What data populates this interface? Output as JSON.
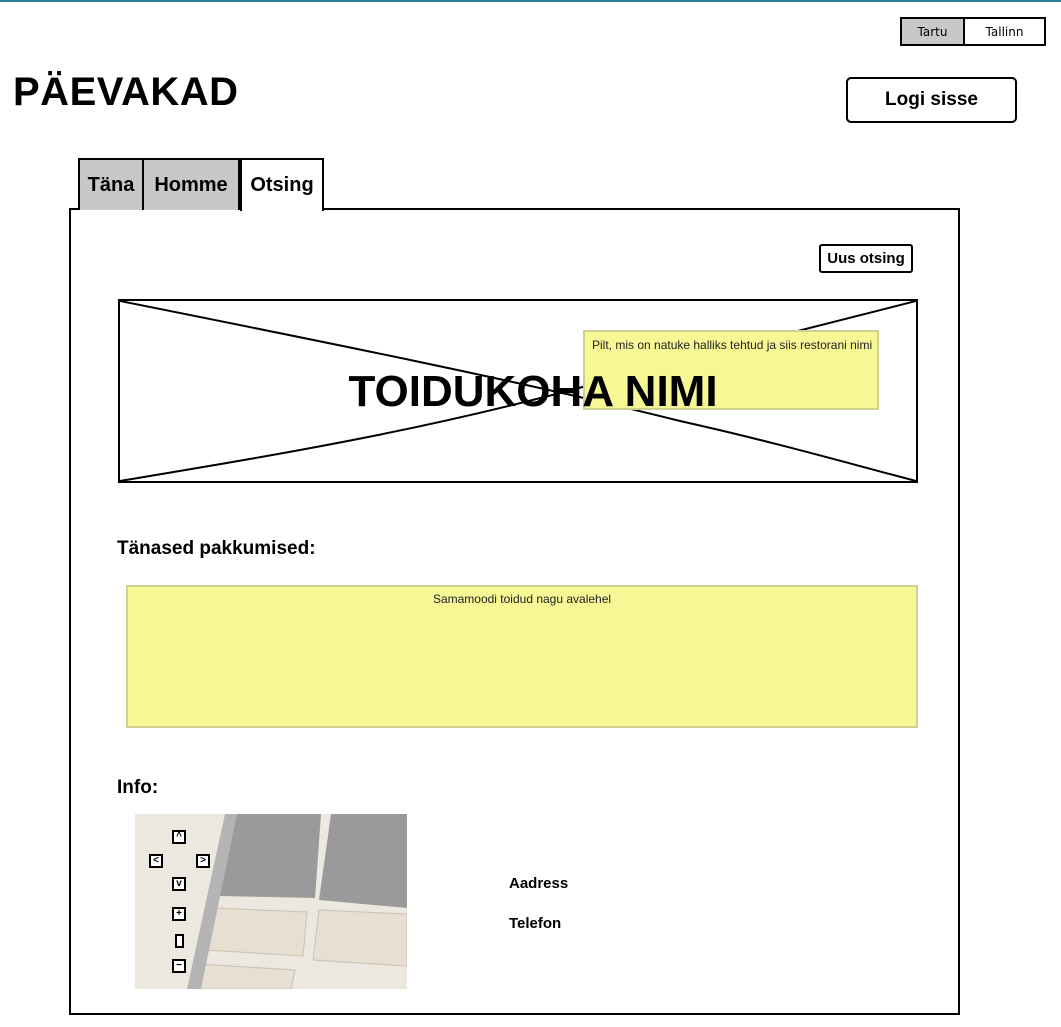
{
  "app": {
    "title": "PÄEVAKAD"
  },
  "city_switch": {
    "active": "Tartu",
    "inactive": "Tallinn"
  },
  "header": {
    "login_label": "Logi sisse"
  },
  "tabs": [
    {
      "label": "Täna",
      "selected": false
    },
    {
      "label": "Homme",
      "selected": false
    },
    {
      "label": "Otsing",
      "selected": true
    }
  ],
  "panel": {
    "new_search_label": "Uus otsing",
    "hero_title": "TOIDUKOHA NIMI",
    "hero_note": "Pilt, mis on natuke halliks tehtud ja siis restorani nimi",
    "offers_heading": "Tänased pakkumised:",
    "offers_note": "Samamoodi toidud nagu avalehel",
    "info_heading": "Info:",
    "address_label": "Aadress",
    "phone_label": "Telefon"
  },
  "map_controls": [
    "chevron-up-icon",
    "chevron-left-icon",
    "chevron-right-icon",
    "chevron-down-icon",
    "plus-icon",
    "slider-icon",
    "minus-icon"
  ],
  "colors": {
    "note_bg": "#f7f795",
    "tab_inactive": "#c8c8c8",
    "accent_line": "#2e7d9a"
  }
}
